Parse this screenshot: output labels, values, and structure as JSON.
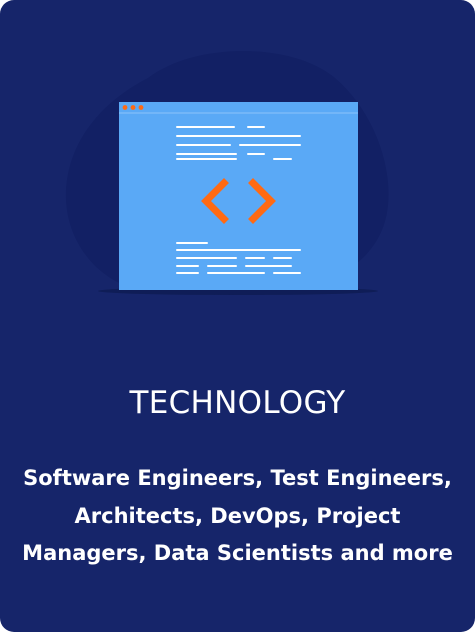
{
  "card": {
    "title": "TECHNOLOGY",
    "description": "Software Engineers, Test Engineers, Architects, DevOps, Project Managers, Data Scientists and more",
    "illustration": {
      "icon": "code-window-icon",
      "blob_icon": "background-blob-shape",
      "dots_icon": "window-dots-icon",
      "brackets_icon": "code-brackets-icon"
    },
    "colors": {
      "background": "#16256a",
      "blob": "#122064",
      "window": "#5aa9f6",
      "accent": "#ff6a13",
      "text": "#ffffff"
    }
  }
}
